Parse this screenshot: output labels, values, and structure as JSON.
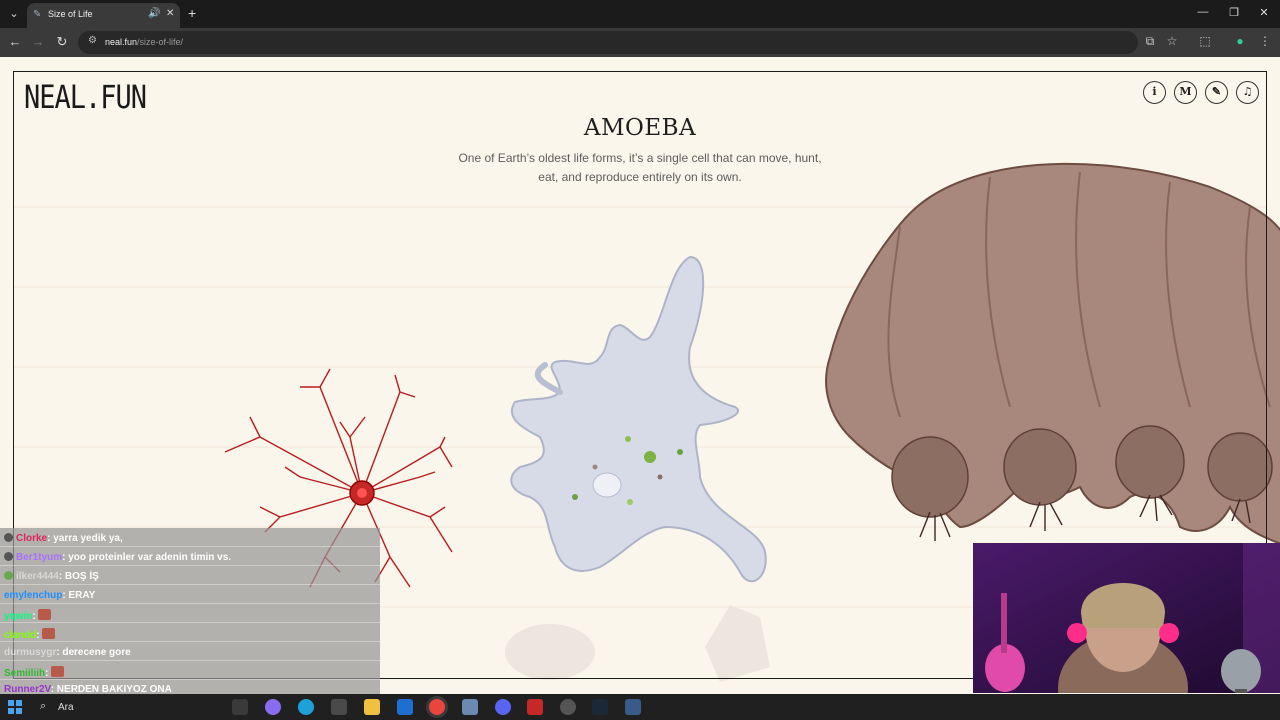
{
  "browser": {
    "tab_title": "Size of Life",
    "url_host": "neal.fun",
    "url_path": "/size-of-life/"
  },
  "site": {
    "logo": "NEAL.FUN",
    "top_icons": [
      "info-icon",
      "medium-icon",
      "pencil-icon",
      "music-note-icon"
    ],
    "top_icon_glyphs": [
      "i",
      "M",
      "✎",
      "♫"
    ]
  },
  "species": {
    "name": "AMOEBA",
    "description_line1": "One of Earth’s oldest life forms, it’s a single cell that can move, hunt,",
    "description_line2": "eat, and reproduce entirely on its own."
  },
  "chat": {
    "messages": [
      {
        "user": "Clorke",
        "user_color": "#e0245e",
        "text": ": yarra yedik ya,"
      },
      {
        "user": "Ber1tyum",
        "user_color": "#a970ff",
        "text": ": yoo proteinler var adenin timin vs."
      },
      {
        "user": "ilker4444",
        "user_color": "#d8d8d8",
        "text": ": BOŞ İŞ"
      },
      {
        "user": "emylenchup",
        "user_color": "#1e90ff",
        "text": ": ERAY"
      },
      {
        "user": "yqwin",
        "user_color": "#00ff7f",
        "text": ":"
      },
      {
        "user": "clandd",
        "user_color": "#7fff00",
        "text": ":"
      },
      {
        "user": "durmusygr",
        "user_color": "#d8d8d8",
        "text": ": derecene gore"
      },
      {
        "user": "Semiiliih",
        "user_color": "#2eb82e",
        "text": ":"
      },
      {
        "user": "Runner2V",
        "user_color": "#9932cc",
        "text": ": NERDEN BAKIYOZ ONA"
      }
    ]
  },
  "taskbar": {
    "search_label": "Ara"
  }
}
